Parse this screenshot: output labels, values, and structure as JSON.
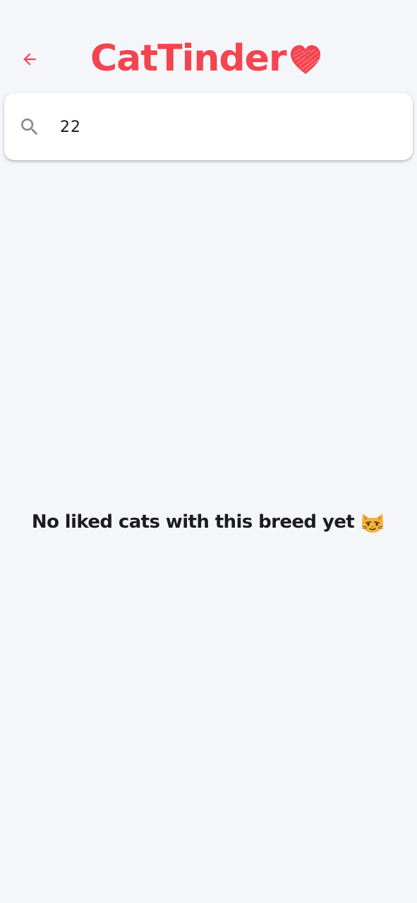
{
  "header": {
    "back_icon": "arrow-back-icon",
    "logo_text": "CatTinder",
    "logo_heart_icon": "heart-icon"
  },
  "search": {
    "icon": "search-icon",
    "value": "22"
  },
  "empty_state": {
    "message": "No liked cats with this breed yet",
    "emoji_icon": "smirking-cat-emoji-icon"
  },
  "colors": {
    "background": "#f5f6fa",
    "accent": "#f2454f",
    "card": "#ffffff",
    "text": "#1c1b22",
    "icon_gray": "#8a8a8a"
  }
}
